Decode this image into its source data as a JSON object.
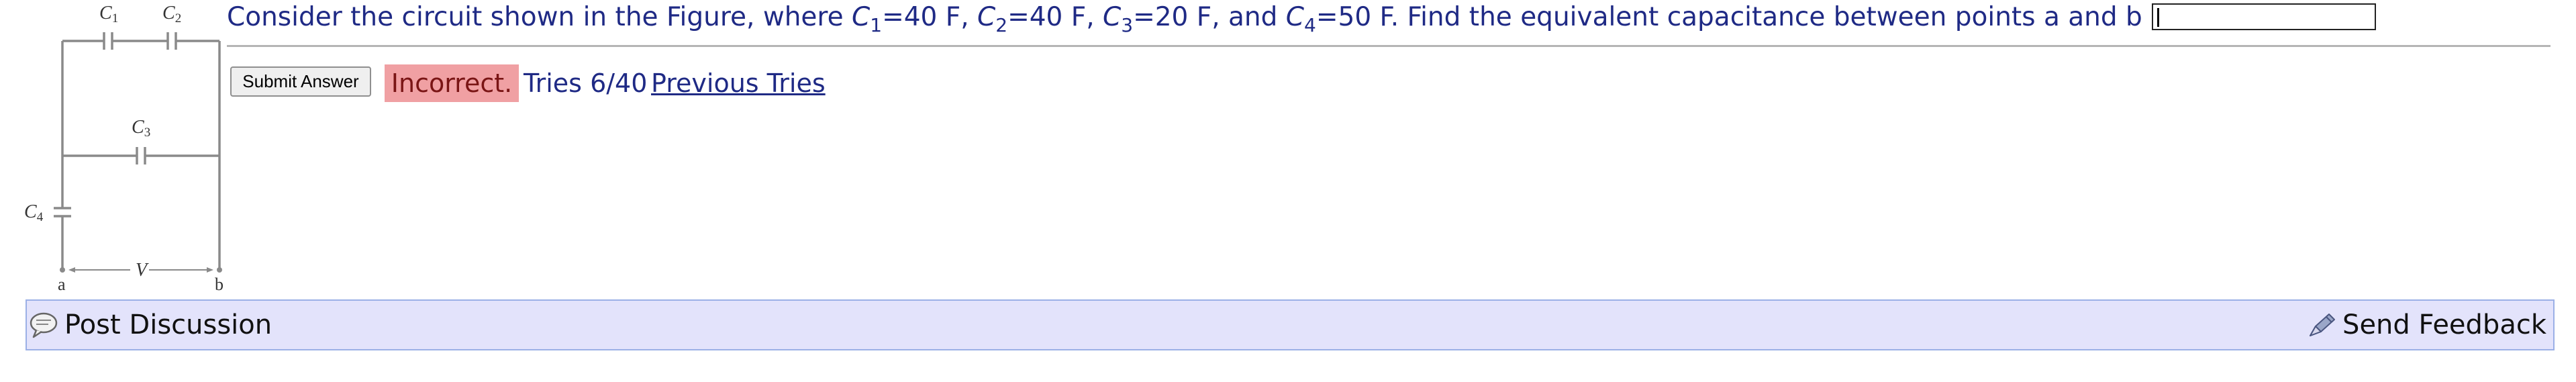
{
  "figure": {
    "labels": {
      "c1_letter": "C",
      "c1_sub": "1",
      "c2_letter": "C",
      "c2_sub": "2",
      "c3_letter": "C",
      "c3_sub": "3",
      "c4_letter": "C",
      "c4_sub": "4",
      "voltage": "V",
      "point_a": "a",
      "point_b": "b"
    }
  },
  "question": {
    "text_1": "Consider the circuit shown in the Figure, where ",
    "c1_letter": "C",
    "c1_sub": "1",
    "c1_value": "=40 F, ",
    "c2_letter": "C",
    "c2_sub": "2",
    "c2_value": "=40 F, ",
    "c3_letter": "C",
    "c3_sub": "3",
    "c3_value": "=20 F, and ",
    "c4_letter": "C",
    "c4_sub": "4",
    "c4_value": "=50 F. Find the equivalent capacitance between points a and b",
    "answer_value": ""
  },
  "submit": {
    "label": "Submit Answer"
  },
  "status": {
    "label": "Incorrect.",
    "tries": "Tries 6/40",
    "previous_tries": "Previous Tries"
  },
  "bottom_bar": {
    "post_discussion": "Post Discussion",
    "send_feedback": "Send Feedback"
  },
  "colors": {
    "question_text": "#1f2a85",
    "incorrect_bg": "#f0a0a3",
    "incorrect_text": "#7a1515",
    "bottom_bar_bg": "#e3e3fb",
    "bottom_bar_border": "#9bb0e6"
  },
  "icons": {
    "post_discussion": "discussion-bubble-icon",
    "send_feedback": "feedback-pencil-icon"
  }
}
